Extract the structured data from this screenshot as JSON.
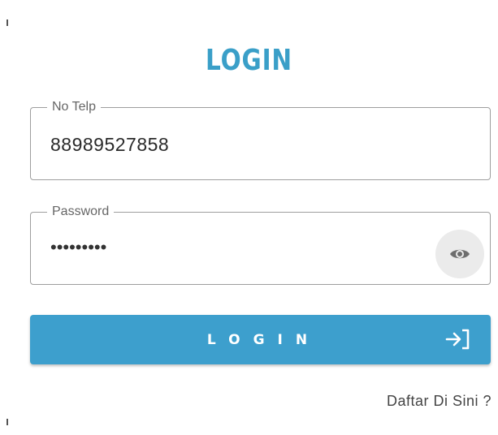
{
  "title": "LOGIN",
  "phone_field": {
    "label": "No Telp",
    "value": "88989527858"
  },
  "password_field": {
    "label": "Password",
    "masked_value": "•••••••••",
    "toggle_icon": "eye-icon"
  },
  "login_button": {
    "label": "LOGIN",
    "icon": "login-icon"
  },
  "register_link": "Daftar Di Sini ?",
  "colors": {
    "accent": "#3a9fc8",
    "button": "#3d9fcd",
    "border": "#9e9e9e",
    "eye_button_bg": "#ebebeb"
  }
}
